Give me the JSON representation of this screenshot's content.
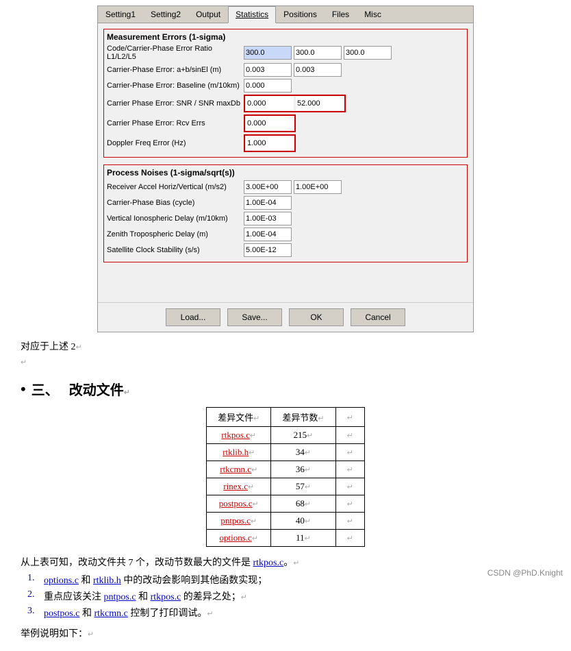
{
  "tabs": {
    "items": [
      {
        "label": "Setting1",
        "active": false
      },
      {
        "label": "Setting2",
        "active": false
      },
      {
        "label": "Output",
        "active": false
      },
      {
        "label": "Statistics",
        "active": true
      },
      {
        "label": "Positions",
        "active": false
      },
      {
        "label": "Files",
        "active": false
      },
      {
        "label": "Misc",
        "active": false
      }
    ]
  },
  "sections": {
    "measurement": {
      "title": "Measurement Errors (1-sigma)",
      "rows": [
        {
          "label": "Code/Carrier-Phase Error Ratio L1/L2/L5",
          "inputs": [
            {
              "value": "300.0",
              "highlighted": true
            },
            {
              "value": "300.0",
              "highlighted": false
            },
            {
              "value": "300.0",
              "highlighted": false
            }
          ]
        },
        {
          "label": "Carrier-Phase Error: a+b/sinEl (m)",
          "inputs": [
            {
              "value": "0.003",
              "highlighted": false
            },
            {
              "value": "0.003",
              "highlighted": false
            }
          ]
        },
        {
          "label": "Carrier-Phase Error: Baseline (m/10km)",
          "inputs": [
            {
              "value": "0.000",
              "highlighted": false
            }
          ]
        },
        {
          "label": "Carrier Phase Error: SNR / SNR maxDb",
          "inputs": [
            {
              "value": "0.000",
              "highlighted": false,
              "red_group": true
            },
            {
              "value": "52.000",
              "highlighted": false,
              "red_group": true
            }
          ],
          "red_group": true
        },
        {
          "label": "Carrier Phase Error: Rcv Errs",
          "inputs": [
            {
              "value": "0.000",
              "highlighted": false,
              "red_group": true
            }
          ],
          "red_group": true
        },
        {
          "label": "Doppler Freq Error (Hz)",
          "inputs": [
            {
              "value": "1.000",
              "highlighted": false,
              "red_group": true
            }
          ],
          "red_group": true
        }
      ]
    },
    "process": {
      "title": "Process Noises (1-sigma/sqrt(s))",
      "rows": [
        {
          "label": "Receiver Accel Horiz/Vertical (m/s2)",
          "inputs": [
            {
              "value": "3.00E+00"
            },
            {
              "value": "1.00E+00"
            }
          ]
        },
        {
          "label": "Carrier-Phase Bias (cycle)",
          "inputs": [
            {
              "value": "1.00E-04"
            }
          ]
        },
        {
          "label": "Vertical Ionospheric Delay (m/10km)",
          "inputs": [
            {
              "value": "1.00E-03"
            }
          ]
        },
        {
          "label": "Zenith Tropospheric Delay (m)",
          "inputs": [
            {
              "value": "1.00E-04"
            }
          ]
        },
        {
          "label": "Satellite Clock Stability (s/s)",
          "inputs": [
            {
              "value": "5.00E-12"
            }
          ]
        }
      ]
    }
  },
  "footer_buttons": {
    "load": "Load...",
    "save": "Save...",
    "ok": "OK",
    "cancel": "Cancel"
  },
  "doc": {
    "para1": "对应于上述 2",
    "para1_end": "↵",
    "para2_end": "↵",
    "section_heading": "三、  改动文件",
    "table": {
      "headers": [
        "差异文件",
        "差异节数"
      ],
      "rows": [
        {
          "file": "rtkpos.c",
          "count": "215"
        },
        {
          "file": "rtklib.h",
          "count": "34"
        },
        {
          "file": "rtkcmn.c",
          "count": "36"
        },
        {
          "file": "rinex.c",
          "count": "57"
        },
        {
          "file": "postpos.c",
          "count": "68"
        },
        {
          "file": "pntpos.c",
          "count": "40"
        },
        {
          "file": "options.c",
          "count": "11"
        }
      ]
    },
    "summary": "从上表可知，改动文件共 7 个，改动节数最大的文件是 rtkpos.c。",
    "list": [
      {
        "num": "1.",
        "text_parts": [
          {
            "text": "options.c",
            "link": true,
            "color": "blue"
          },
          {
            "text": " 和 ",
            "link": false
          },
          {
            "text": "rtklib.h",
            "link": true,
            "color": "blue"
          },
          {
            "text": " 中的改动会影响到其他函数实现；",
            "link": false
          }
        ]
      },
      {
        "num": "2.",
        "text_parts": [
          {
            "text": "重点应该关注 ",
            "link": false
          },
          {
            "text": "pntpos.c",
            "link": true,
            "color": "blue"
          },
          {
            "text": " 和 ",
            "link": false
          },
          {
            "text": "rtkpos.c",
            "link": true,
            "color": "blue"
          },
          {
            "text": " 的差异之处；",
            "link": false
          }
        ]
      },
      {
        "num": "3.",
        "text_parts": [
          {
            "text": "postpos.c",
            "link": true,
            "color": "blue"
          },
          {
            "text": " 和 ",
            "link": false
          },
          {
            "text": "rtkcmn.c",
            "link": true,
            "color": "blue"
          },
          {
            "text": " 控制了打印调试。",
            "link": false
          }
        ]
      }
    ],
    "example_text": "举例说明如下：",
    "watermark": "CSDN @PhD.Knight"
  }
}
